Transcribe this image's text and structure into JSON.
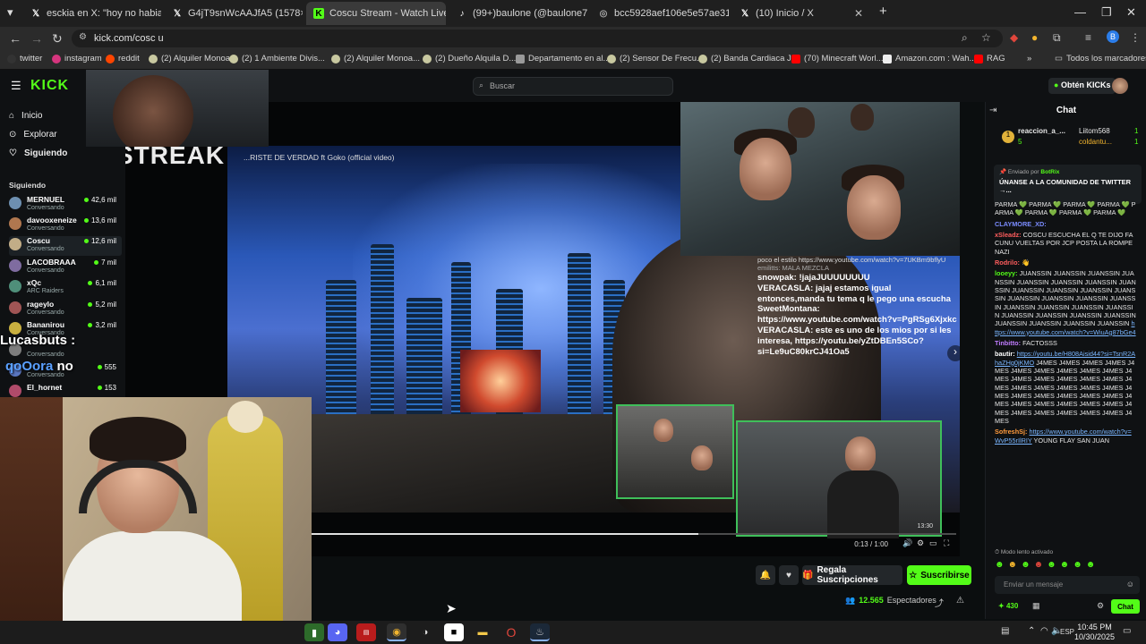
{
  "tabs": [
    {
      "label": "esckia en X: \"hoy no habia mu",
      "icon": "x-logo-icon"
    },
    {
      "label": "G4jT9snWcAAJfA5 (1578×934)",
      "icon": "x-logo-icon"
    },
    {
      "label": "Coscu Stream - Watch Live on K",
      "icon": "kick-logo-icon",
      "active": true
    },
    {
      "label": "(99+)baulone (@baulone7) | Tik",
      "icon": "tiktok-icon"
    },
    {
      "label": "bcc5928aef106e5e57ae31cc682",
      "icon": "globe-icon"
    },
    {
      "label": "(10) Inicio / X",
      "icon": "x-logo-icon"
    }
  ],
  "address": {
    "url": "kick.com/cosc u"
  },
  "bookmarks": [
    {
      "label": "twitter"
    },
    {
      "label": "instagram"
    },
    {
      "label": "reddit"
    },
    {
      "label": "(2) Alquiler Monoa..."
    },
    {
      "label": "(2) 1 Ambiente Divis..."
    },
    {
      "label": "(2) Alquiler Monoa..."
    },
    {
      "label": "(2) Dueño Alquila D..."
    },
    {
      "label": "Departamento en al..."
    },
    {
      "label": "(2) Sensor De Frecu..."
    },
    {
      "label": "(2) Banda Cardiaca J..."
    },
    {
      "label": "(70) Minecraft Worl..."
    },
    {
      "label": "Amazon.com : Wah..."
    },
    {
      "label": "RAG"
    }
  ],
  "bookmarks_all": "Todos los marcadores",
  "kick": {
    "logo": "KICK",
    "search_placeholder": "Buscar",
    "get_kicks": "Obtén KICKs"
  },
  "sidebar": {
    "nav": [
      {
        "label": "Inicio",
        "icon": "home-icon"
      },
      {
        "label": "Explorar",
        "icon": "compass-icon"
      },
      {
        "label": "Siguiendo",
        "icon": "heart-icon"
      }
    ],
    "following_heading": "Siguiendo",
    "following": [
      {
        "name": "MERNUEL",
        "category": "Conversando",
        "viewers": "42,6 mil",
        "color": "#6d8fb0"
      },
      {
        "name": "davooxeneize",
        "category": "Conversando",
        "viewers": "13,6 mil",
        "color": "#b0774f"
      },
      {
        "name": "Coscu",
        "category": "Conversando",
        "viewers": "12,6 mil",
        "color": "#c2ad87"
      },
      {
        "name": "LACOBRAAA",
        "category": "Conversando",
        "viewers": "7 mil",
        "color": "#7f6ca0"
      },
      {
        "name": "xQc",
        "category": "ARC Raiders",
        "viewers": "6,1 mil",
        "color": "#4f8f7a"
      },
      {
        "name": "rageylo",
        "category": "Conversando",
        "viewers": "5,2 mil",
        "color": "#a05555"
      },
      {
        "name": "Bananirou",
        "category": "Conversando",
        "viewers": "3,2 mil",
        "color": "#c9b040"
      },
      {
        "name": "Lucasbuts",
        "category": "Conversando",
        "viewers": "",
        "color": "#7d7d7d"
      },
      {
        "name": "qo...",
        "category": "Conversando",
        "viewers": "555",
        "color": "#5a76c0"
      },
      {
        "name": "El_hornet",
        "category": "Conversando",
        "viewers": "153",
        "color": "#b04b6a"
      }
    ]
  },
  "video": {
    "overlay_title": "...RISTE DE VERDAD ft Goko (official video)",
    "streak_text": "4x STREAK",
    "time": "0:13 / 1:00",
    "progress_fraction": 0.6,
    "overlay_chat": [
      {
        "text": "poco el estilo https://www.youtube.com/watch?v=7UKBm9bflyU",
        "big": false
      },
      {
        "text": "emilitts: MALA MEZCLA",
        "big": false
      },
      {
        "text": "snowpak: !jajaJUUUUUUUU",
        "big": true
      },
      {
        "text": "VERACASLA: jajaj estamos igual",
        "big": true
      },
      {
        "text": "entonces,manda tu tema q le pego una escucha",
        "big": true
      },
      {
        "text": "SweetMontana:",
        "big": true
      },
      {
        "text": "https://www.youtube.com/watch?v=PgRSg6Xjxkc",
        "big": true
      },
      {
        "text": "VERACASLA: este es uno de los mios por si les interesa, https://youtu.be/yZtDBEn5SCo?si=Le9uC80krCJ41Oa5",
        "big": true
      }
    ],
    "overlay_time": "13:30"
  },
  "webcam_overlays": {
    "lucas": "Lucasbuts :",
    "qobra_left": "qoOora",
    "qobra_right": "no"
  },
  "actions": {
    "gift_subs": "Regala Suscripciones",
    "subscribe": "Suscribirse",
    "viewers": "12.565",
    "viewers_label": "Espectadores"
  },
  "chat": {
    "title": "Chat",
    "top_gifters": [
      {
        "name": "reaccion_a_...",
        "count": "5"
      },
      {
        "name": "Liitom568",
        "count": "1"
      },
      {
        "name": "coldantu...",
        "count": "1"
      }
    ],
    "pinned_sender_prefix": "Enviado por",
    "pinned_sender": "BotRix",
    "pinned_text": "ÚNANSE A LA COMUNIDAD DE TWITTER →...",
    "messages": [
      {
        "user": "",
        "color": "#ffffff",
        "text": "PARMA 💚 PARMA 💚 PARMA 💚 PARMA 💚 PARMA 💚 PARMA 💚 PARMA 💚 PARMA 💚"
      },
      {
        "user": "CLAYMORE_XD:",
        "color": "#7b8cff",
        "text": ""
      },
      {
        "user": "xSleadz:",
        "color": "#ff5d5d",
        "text": "COSCU ESCUCHA EL Q TE DIJO FACUNU VUELTAS POR JCP POSTA LA ROMPE NAZI"
      },
      {
        "user": "Rodrilo:",
        "color": "#ff5d5d",
        "text": ""
      },
      {
        "user": "looeyy:",
        "color": "#53fc18",
        "text": "JUANSSIN JUANSSIN JUANSSIN JUANSSIN JUANSSIN JUANSSIN JUANSSIN JUANSSIN JUANSSIN JUANSSIN JUANSSIN JUANSSIN JUANSSIN JUANSSIN JUANSSIN JUANSSIN JUANSSIN JUANSSIN JUANSSIN JUANSSIN JUANSSIN JUANSSIN JUANSSIN JUANSSIN JUANSSIN JUANSSIN JUANSSIN JUANSSIN"
      },
      {
        "user": "",
        "color": "",
        "text": "",
        "link": "https://www.youtube.com/watch?v=WiuAg87bGe4"
      },
      {
        "user": "Tinbitto:",
        "color": "#c07cff",
        "text": "FACTOSSS"
      },
      {
        "user": "bautir:",
        "color": "#ffffff",
        "text": "J4MES J4MES J4MES J4MES J4MES J4MES J4MES J4MES J4MES J4MES J4MES J4MES J4MES J4MES J4MES J4MES J4MES J4MES J4MES J4MES J4MES J4MES J4MES J4MES J4MES J4MES J4MES J4MES J4MES J4MES J4MES J4MES J4MES J4MES J4MES J4MES J4MES J4MES J4MES J4MES J4MES",
        "link": "https://youtu.be/H808Aisid44?si=TsnR2AhaZHg0jKMO"
      },
      {
        "user": "SofreshSj:",
        "color": "#ff9a3c",
        "text": "YOUNG FLAY SAN JUAN",
        "link": "https://www.youtube.com/watch?v=WvP55rIlRIY"
      }
    ],
    "slow_mode": "Modo lento activado",
    "input_placeholder": "Enviar un mensaje",
    "points": "430",
    "send_label": "Chat"
  },
  "taskbar": {
    "lang": "ESP",
    "time": "10:45 PM",
    "date": "10/30/2025"
  }
}
